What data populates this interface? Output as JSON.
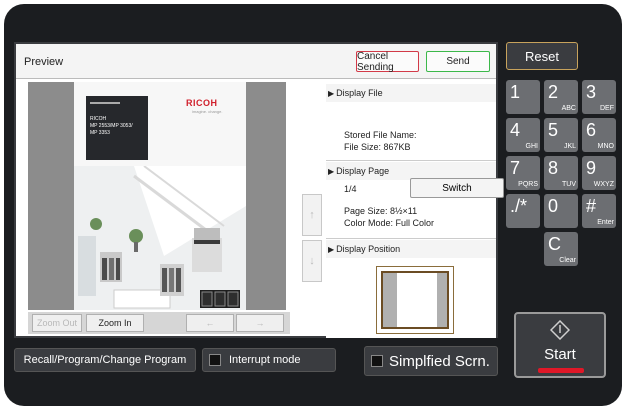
{
  "window": {
    "title": "Preview"
  },
  "toolbar": {
    "cancel_label": "Cancel Sending",
    "send_label": "Send"
  },
  "document": {
    "brand": "RICOH",
    "brand_sub": "imagine. change.",
    "cover_lines": [
      "RICOH",
      "MP 2553/MP 3053/",
      "MP 3353"
    ]
  },
  "preview_controls": {
    "zoom_out": "Zoom Out",
    "zoom_in": "Zoom In",
    "prev": "←",
    "next": "→",
    "up": "↑",
    "down": "↓"
  },
  "info": {
    "display_file": {
      "header": "Display File",
      "stored_name_label": "Stored File Name:",
      "file_size": "File Size: 867KB"
    },
    "display_page": {
      "header": "Display Page",
      "page": "1/4",
      "switch_label": "Switch",
      "page_size": "Page Size: 8½×11",
      "color_mode": "Color Mode: Full Color"
    },
    "display_position": {
      "header": "Display Position"
    }
  },
  "bottom": {
    "recall": "Recall/Program/Change Program",
    "interrupt": "Interrupt mode",
    "simplified": "Simplfied Scrn."
  },
  "panel": {
    "reset": "Reset",
    "start": "Start",
    "keys": [
      {
        "main": "1",
        "sub": ""
      },
      {
        "main": "2",
        "sub": "ABC"
      },
      {
        "main": "3",
        "sub": "DEF"
      },
      {
        "main": "4",
        "sub": "GHI"
      },
      {
        "main": "5",
        "sub": "JKL"
      },
      {
        "main": "6",
        "sub": "MNO"
      },
      {
        "main": "7",
        "sub": "PQRS"
      },
      {
        "main": "8",
        "sub": "TUV"
      },
      {
        "main": "9",
        "sub": "WXYZ"
      },
      {
        "main": "./*",
        "sub": ""
      },
      {
        "main": "0",
        "sub": ""
      },
      {
        "main": "#",
        "sub": "Enter"
      },
      {
        "main": "C",
        "sub": "Clear"
      }
    ]
  },
  "colors": {
    "cancel_border": "#d23a48",
    "send_border": "#3cb84a",
    "reset_border": "#c8a35c",
    "start_accent": "#e01828",
    "ricoh_red": "#d0202c"
  },
  "icons": {
    "night": "moon-icon",
    "start": "diamond-start-icon"
  }
}
